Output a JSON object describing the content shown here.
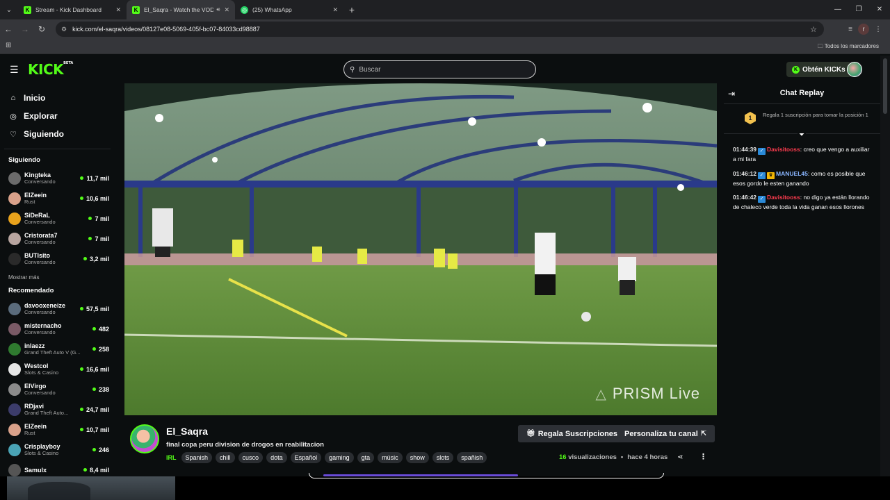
{
  "browser": {
    "tabs": [
      {
        "title": "Stream - Kick Dashboard",
        "icon": "kick-icon",
        "active": false
      },
      {
        "title": "El_Saqra - Watch the VOD o",
        "icon": "kick-icon",
        "active": true
      },
      {
        "title": "(25) WhatsApp",
        "icon": "whatsapp-icon",
        "active": false
      }
    ],
    "url": "kick.com/el-saqra/videos/08127e08-5069-405f-bc07-84033cd98887",
    "bookmarks_all": "Todos los marcadores",
    "profile_letter": "r"
  },
  "header": {
    "logo": "KICK",
    "logo_beta": "BETA",
    "search_placeholder": "Buscar",
    "kicks_button": "Obtén KICKs"
  },
  "sidebar": {
    "nav": [
      {
        "label": "Inicio",
        "icon": "home-icon"
      },
      {
        "label": "Explorar",
        "icon": "compass-icon"
      },
      {
        "label": "Siguiendo",
        "icon": "heart-icon"
      }
    ],
    "following_header": "Siguiendo",
    "following": [
      {
        "name": "Kingteka",
        "category": "Conversando",
        "viewers": "11,7 mil",
        "color": "#6b6b6b"
      },
      {
        "name": "ElZeein",
        "category": "Rust",
        "viewers": "10,6 mil",
        "color": "#d9a18a"
      },
      {
        "name": "SiDeRaL",
        "category": "Conversando",
        "viewers": "7 mil",
        "color": "#e8a21c"
      },
      {
        "name": "Cristorata7",
        "category": "Conversando",
        "viewers": "7 mil",
        "color": "#b8a5a0"
      },
      {
        "name": "BUTIsito",
        "category": "Conversando",
        "viewers": "3,2 mil",
        "color": "#2a2a2a"
      }
    ],
    "show_more": "Mostrar más",
    "recommended_header": "Recomendado",
    "recommended": [
      {
        "name": "davooxeneize",
        "category": "Conversando",
        "viewers": "57,5 mil",
        "color": "#5a6b7c"
      },
      {
        "name": "misternacho",
        "category": "Conversando",
        "viewers": "482",
        "color": "#7a5a66"
      },
      {
        "name": "inlaezz",
        "category": "Grand Theft Auto V (G...",
        "viewers": "258",
        "color": "#2f7a2f"
      },
      {
        "name": "Westcol",
        "category": "Slots & Casino",
        "viewers": "16,6 mil",
        "color": "#e6e6e6"
      },
      {
        "name": "ElVirgo",
        "category": "Conversando",
        "viewers": "238",
        "color": "#8b8b8b"
      },
      {
        "name": "RDjavi",
        "category": "Grand Theft Auto...",
        "viewers": "24,7 mil",
        "color": "#3c3c6b"
      },
      {
        "name": "ElZeein",
        "category": "Rust",
        "viewers": "10,7 mil",
        "color": "#d9a18a"
      },
      {
        "name": "Crisplayboy",
        "category": "Slots & Casino",
        "viewers": "246",
        "color": "#4aa3b5"
      },
      {
        "name": "Samulx",
        "category": "",
        "viewers": "8,4 mil",
        "color": "#555"
      }
    ]
  },
  "video": {
    "watermark": "PRISM Live"
  },
  "channel": {
    "name": "El_Saqra",
    "title": "final copa peru division de drogos en reabilitacion",
    "category": "IRL",
    "tags": [
      "Spanish",
      "chill",
      "cusco",
      "dota",
      "Español",
      "gaming",
      "gta",
      "músic",
      "show",
      "slots",
      "spañish"
    ],
    "gift_button": "Regala Suscripciones",
    "customize_button": "Personaliza tu canal",
    "views_count": "16",
    "views_label": "visualizaciones",
    "ago": "hace 4 horas"
  },
  "chat": {
    "title": "Chat Replay",
    "pinned_rank": "1",
    "pinned_text": "Regala 1 suscripción para tomar la posición 1",
    "messages": [
      {
        "time": "01:44:39",
        "user": "Davisitooss",
        "text": ": creo que vengo a auxiliar a mi fara",
        "style": "u1",
        "badges": [
          "verified"
        ]
      },
      {
        "time": "01:46:12",
        "user": "MANUEL45",
        "text": ": como es posible que esos gordo le esten ganando",
        "style": "u2",
        "badges": [
          "verified",
          "crown"
        ]
      },
      {
        "time": "01:46:42",
        "user": "Davisitooss",
        "text": ": no digo ya están llorando de chaleco verde toda la vida ganan esos llorones",
        "style": "u1",
        "badges": [
          "verified"
        ]
      }
    ]
  }
}
